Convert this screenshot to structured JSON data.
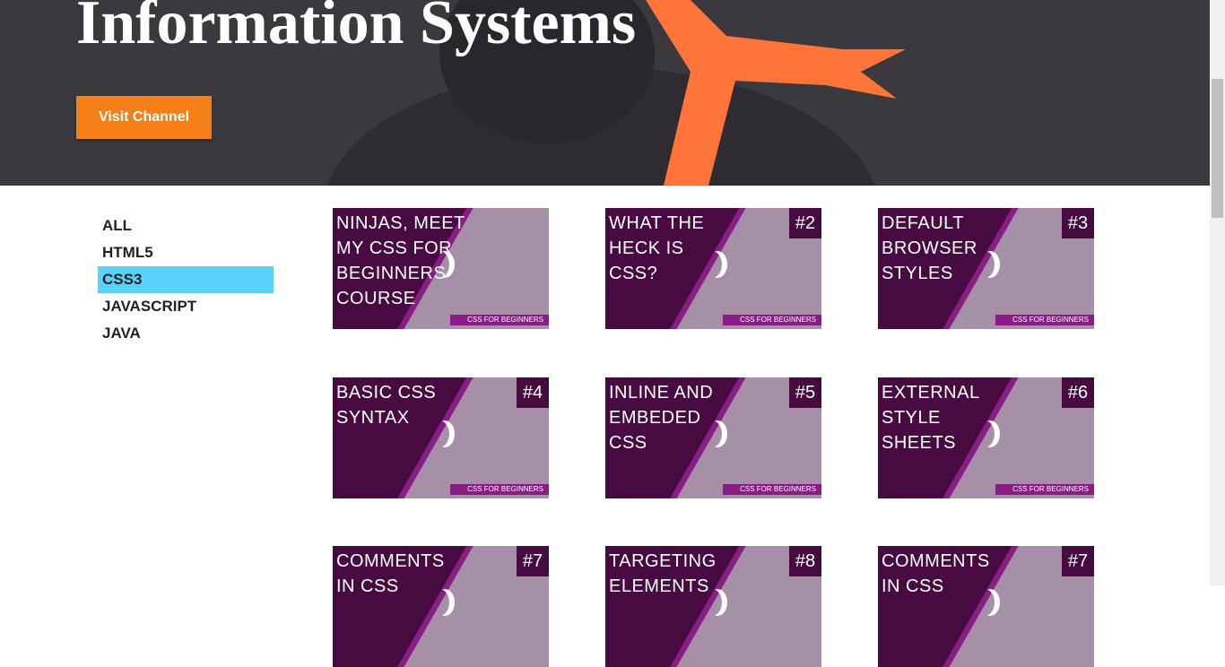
{
  "header": {
    "title": "Information Systems",
    "visit_button": "Visit Channel",
    "ribbon_color": "#ff7438"
  },
  "sidebar": {
    "items": [
      {
        "label": "ALL"
      },
      {
        "label": "HTML5"
      },
      {
        "label": "CSS3",
        "active": true
      },
      {
        "label": "JAVASCRIPT"
      },
      {
        "label": "JAVA"
      }
    ],
    "active_color": "#5ad1f8"
  },
  "videos": [
    {
      "title": "NINJAS, MEET\nMY CSS FOR\nBEGINNERS\nCOURSE",
      "number": "",
      "series": "CSS FOR BEGINNERS"
    },
    {
      "title": "WHAT THE\nHECK IS\nCSS?",
      "number": "#2",
      "series": "CSS FOR BEGINNERS"
    },
    {
      "title": "DEFAULT\nBROWSER\nSTYLES",
      "number": "#3",
      "series": "CSS FOR BEGINNERS"
    },
    {
      "title": "BASIC CSS\nSYNTAX",
      "number": "#4",
      "series": "CSS FOR BEGINNERS"
    },
    {
      "title": "INLINE AND\nEMBEDED\nCSS",
      "number": "#5",
      "series": "CSS FOR BEGINNERS"
    },
    {
      "title": "EXTERNAL\nSTYLE\nSHEETS",
      "number": "#6",
      "series": "CSS FOR BEGINNERS"
    },
    {
      "title": "COMMENTS\nIN CSS",
      "number": "#7",
      "series": ""
    },
    {
      "title": "TARGETING\nELEMENTS",
      "number": "#8",
      "series": ""
    },
    {
      "title": "COMMENTS\nIN CSS",
      "number": "#7",
      "series": ""
    }
  ]
}
